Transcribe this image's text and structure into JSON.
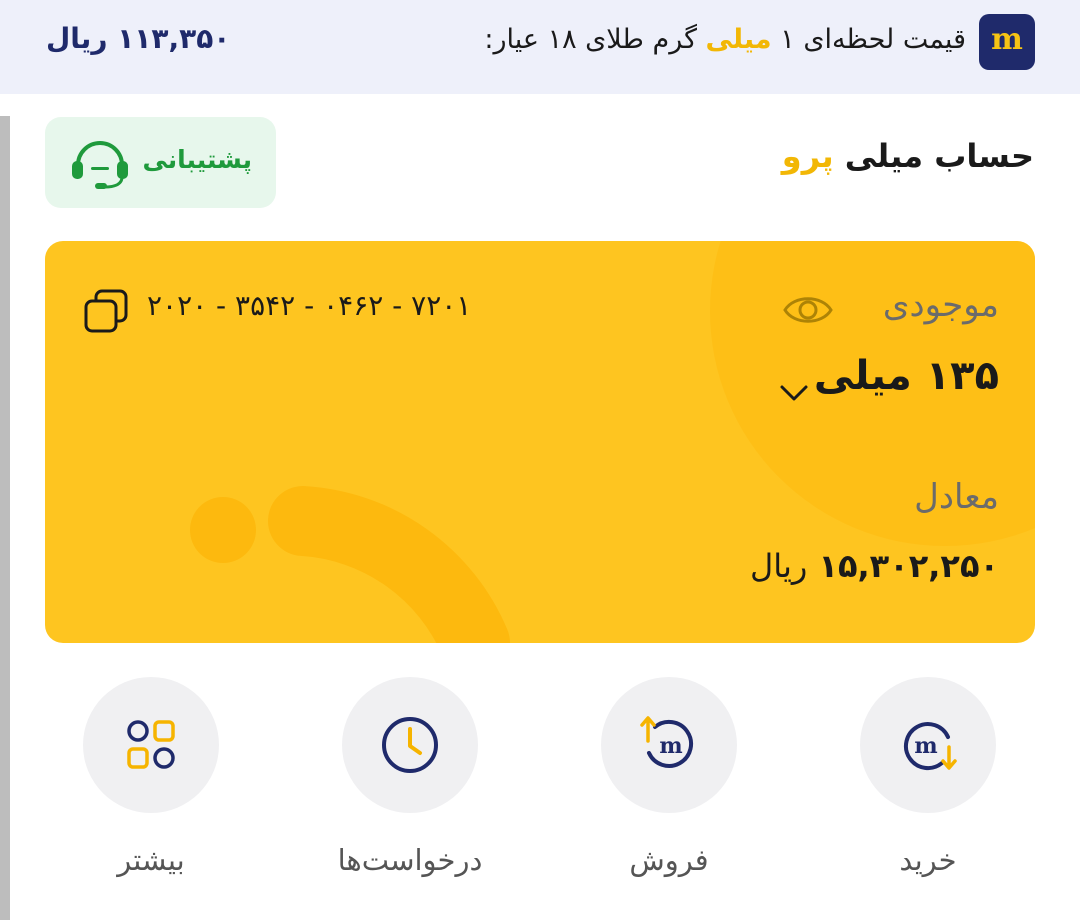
{
  "header": {
    "logo_letter": "m",
    "live_price_prefix": "قیمت لحظه‌ای ۱",
    "live_price_highlight": "میلی",
    "live_price_suffix": "گرم طلای ۱۸ عیار:",
    "live_price_value": "۱۱۳,۳۵۰ ریال"
  },
  "account": {
    "title_main": "حساب میلی",
    "title_highlight": "پرو",
    "support_label": "پشتیبانی"
  },
  "card": {
    "number": "۲۰۲۰ - ۳۵۴۲ - ۰۴۶۲ - ۷۲۰۱",
    "balance_label": "موجودی",
    "balance_value": "۱۳۵ میلی",
    "equiv_label": "معادل",
    "equiv_amount": "۱۵,۳۰۲,۲۵۰",
    "equiv_unit": "ریال"
  },
  "actions": [
    {
      "label": "خرید",
      "icon": "buy-icon"
    },
    {
      "label": "فروش",
      "icon": "sell-icon"
    },
    {
      "label": "درخواست‌ها",
      "icon": "clock-icon"
    },
    {
      "label": "بیشتر",
      "icon": "grid-icon"
    }
  ],
  "colors": {
    "brand_navy": "#1f2a6b",
    "brand_gold": "#f6c414",
    "card_yellow": "#fec520",
    "support_green": "#1f9a3c"
  }
}
